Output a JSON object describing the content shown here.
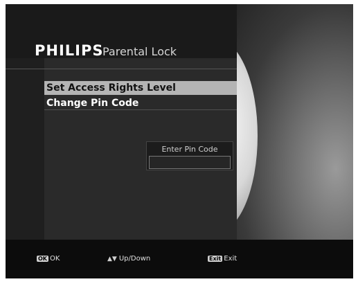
{
  "header": {
    "brand": "PHILIPS",
    "title": "Parental Lock"
  },
  "menu": {
    "items": [
      {
        "label": "Set Access Rights Level",
        "selected": true
      },
      {
        "label": "Change Pin Code",
        "selected": false
      }
    ]
  },
  "pin_dialog": {
    "label": "Enter Pin Code",
    "value": ""
  },
  "footer": {
    "ok": {
      "key": "OK",
      "label": "OK"
    },
    "updown": {
      "key": "▲▼",
      "label": "Up/Down"
    },
    "exit": {
      "key": "Exit",
      "label": "Exit"
    }
  }
}
